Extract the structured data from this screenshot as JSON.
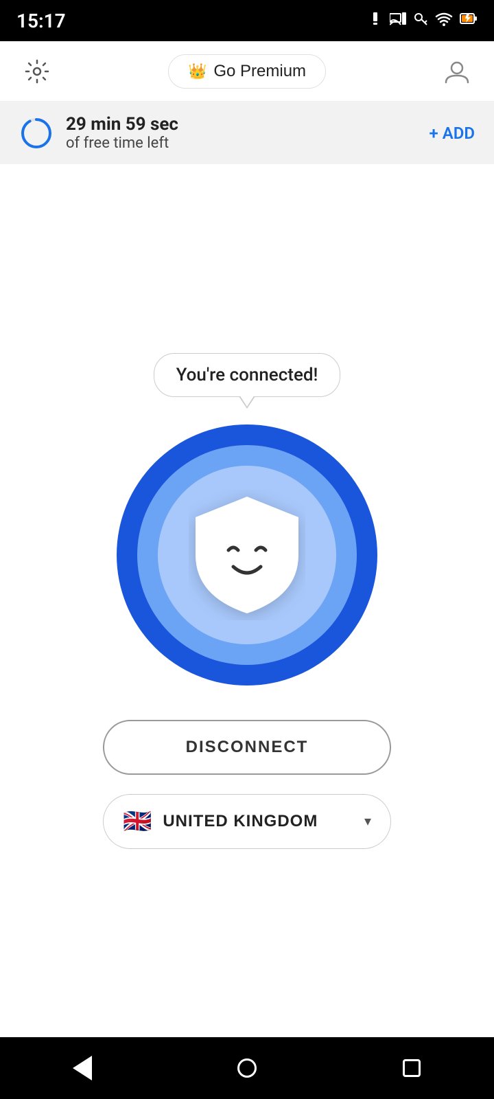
{
  "statusBar": {
    "time": "15:17",
    "icons": [
      "alert",
      "cast",
      "key",
      "wifi",
      "battery"
    ]
  },
  "topNav": {
    "settingsLabel": "Settings",
    "premiumLabel": "Go Premium",
    "crownIcon": "👑",
    "accountLabel": "Account"
  },
  "freTimeBanner": {
    "timeMain": "29 min 59 sec",
    "timeSub": "of free time left",
    "addLabel": "+ ADD"
  },
  "main": {
    "connectedText": "You're connected!",
    "disconnectLabel": "DISCONNECT",
    "locationLabel": "UNITED KINGDOM",
    "flagEmoji": "🇬🇧",
    "dropdownArrow": "▾"
  },
  "bottomNav": {
    "backLabel": "Back",
    "homeLabel": "Home",
    "recentLabel": "Recent"
  }
}
